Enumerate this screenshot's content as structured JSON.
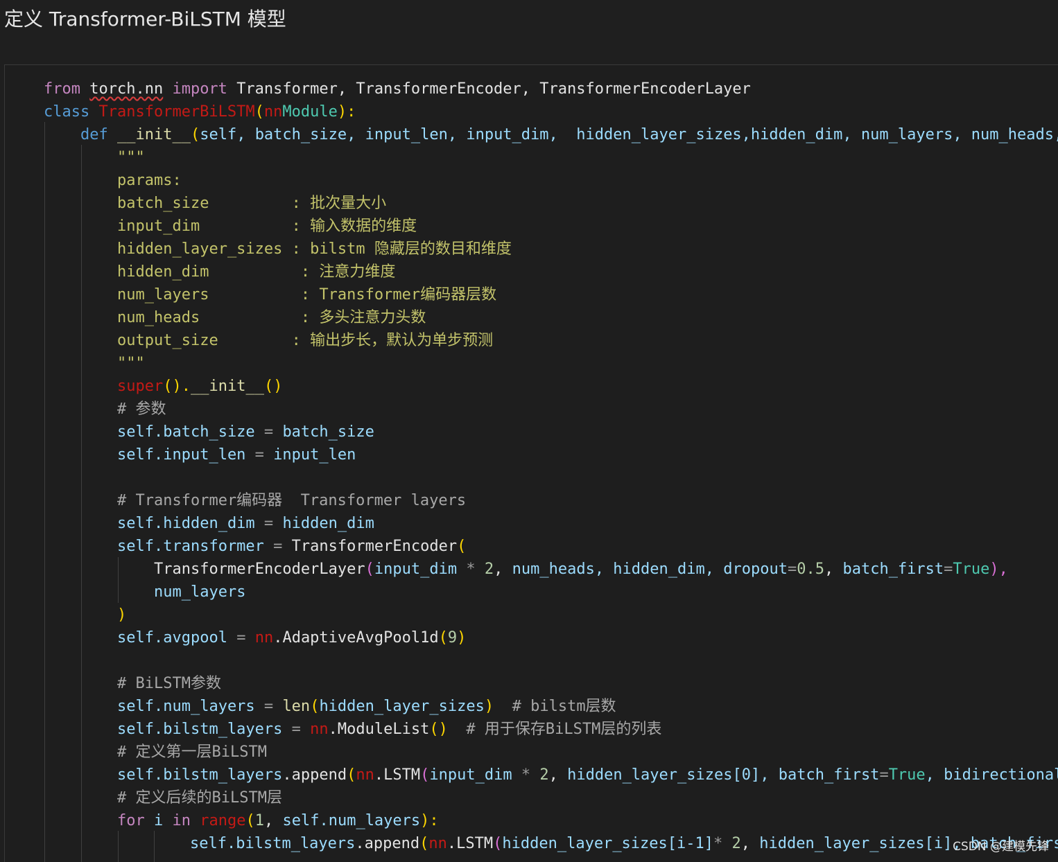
{
  "heading": "定义 Transformer-BiLSTM 模型",
  "watermark": "CSDN @建模先锋",
  "code": {
    "l01": {
      "a": "from",
      "b": "torch.nn",
      "c": "import",
      "d": "Transformer, TransformerEncoder, TransformerEncoderLayer"
    },
    "l02": {
      "a": "class",
      "b": "TransformerBiLSTM",
      "c": "(",
      "d": "nn",
      ".": ".",
      "e": "Module",
      "f": "):"
    },
    "l03": {
      "a": "def",
      "b": "__init__",
      "c": "(",
      "d": "self, batch_size, input_len, input_dim,  hidden_layer_sizes,hidden_dim, num_layers, num_heads,"
    },
    "l04": "\"\"\"",
    "l05": "params:",
    "l06": "batch_size         : 批次量大小",
    "l07": "input_dim          : 输入数据的维度",
    "l08": "hidden_layer_sizes : bilstm 隐藏层的数目和维度",
    "l09": "hidden_dim          : 注意力维度",
    "l10": "num_layers          : Transformer编码器层数",
    "l11": "num_heads           : 多头注意力头数",
    "l12": "output_size        : 输出步长，默认为单步预测",
    "l13": "\"\"\"",
    "l14": {
      "a": "super",
      "b": "().",
      "c": "__init__",
      "d": "()"
    },
    "l15": "# 参数",
    "l16": {
      "a": "self.batch_size",
      "b": " = ",
      "c": "batch_size"
    },
    "l17": {
      "a": "self.input_len",
      "b": " = ",
      "c": "input_len"
    },
    "l18": "# Transformer编码器  Transformer layers",
    "l19": {
      "a": "self.hidden_dim",
      "b": " = ",
      "c": "hidden_dim"
    },
    "l20": {
      "a": "self.transformer",
      "b": " = ",
      "c": "TransformerEncoder",
      "d": "("
    },
    "l21": {
      "a": "TransformerEncoderLayer",
      "b": "(",
      "c": "input_dim",
      "d": " * ",
      "e": "2",
      "f": ", ",
      "g": "num_heads, hidden_dim, dropout",
      "h": "=",
      "i": "0.5",
      ",": ", ",
      "j": "batch_first",
      "k": "True",
      "l": "),"
    },
    "l22": "num_layers",
    "l23": ")",
    "l24": {
      "a": "self.avgpool",
      "b": " = ",
      "c": "nn",
      "d": ".AdaptiveAvgPool1d",
      "e": "(",
      "f": "9",
      "g": ")"
    },
    "l25": "# BiLSTM参数",
    "l26": {
      "a": "self.num_layers",
      "b": " = ",
      "c": "len",
      "d": "(",
      "e": "hidden_layer_sizes",
      "f": ")",
      "g": "  # bilstm层数"
    },
    "l27": {
      "a": "self.bilstm_layers",
      "b": " = ",
      "c": "nn",
      "d": ".ModuleList",
      "e": "()",
      "f": "  # 用于保存BiLSTM层的列表"
    },
    "l28": "# 定义第一层BiLSTM",
    "l29": {
      "a": "self.bilstm_layers",
      "b": ".append",
      "c": "(",
      "d": "nn",
      "e": ".LSTM",
      "f": "(",
      "g": "input_dim",
      "h": " * ",
      "i": "2",
      "j": ", ",
      "k": "hidden_layer_sizes[0], batch_first",
      "l": "=",
      "m": "True",
      "n": ", bidirectional"
    },
    "l30": "# 定义后续的BiLSTM层",
    "l31": {
      "a": "for",
      "b": " i ",
      "c": "in",
      "d": " range",
      "e": "(",
      "f": "1",
      ",": ", ",
      "g": "self.num_layers",
      "h": "):"
    },
    "l32": {
      "a": "self.bilstm_layers",
      "b": ".append",
      "c": "(",
      "d": "nn",
      "e": ".LSTM",
      "f": "(",
      "g": "hidden_layer_sizes[i-1]",
      "h": "* ",
      "i": "2",
      "j": ", ",
      "k": "hidden_layer_sizes[i], batch_firs"
    }
  }
}
